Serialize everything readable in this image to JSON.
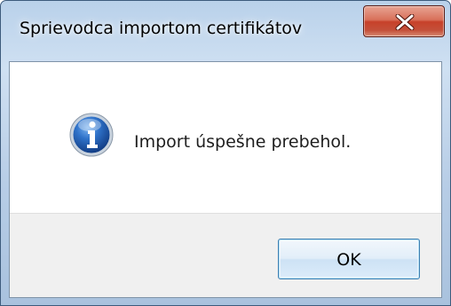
{
  "window": {
    "title": "Sprievodca importom certifikátov"
  },
  "titlebar": {
    "close_icon": "close-icon"
  },
  "dialog": {
    "icon": "info-icon",
    "message": "Import úspešne prebehol."
  },
  "buttons": {
    "ok_label": "OK"
  },
  "colors": {
    "close_button": "#c7412a",
    "info_icon": "#1f5fb3",
    "ok_border": "#3c7fb1"
  }
}
